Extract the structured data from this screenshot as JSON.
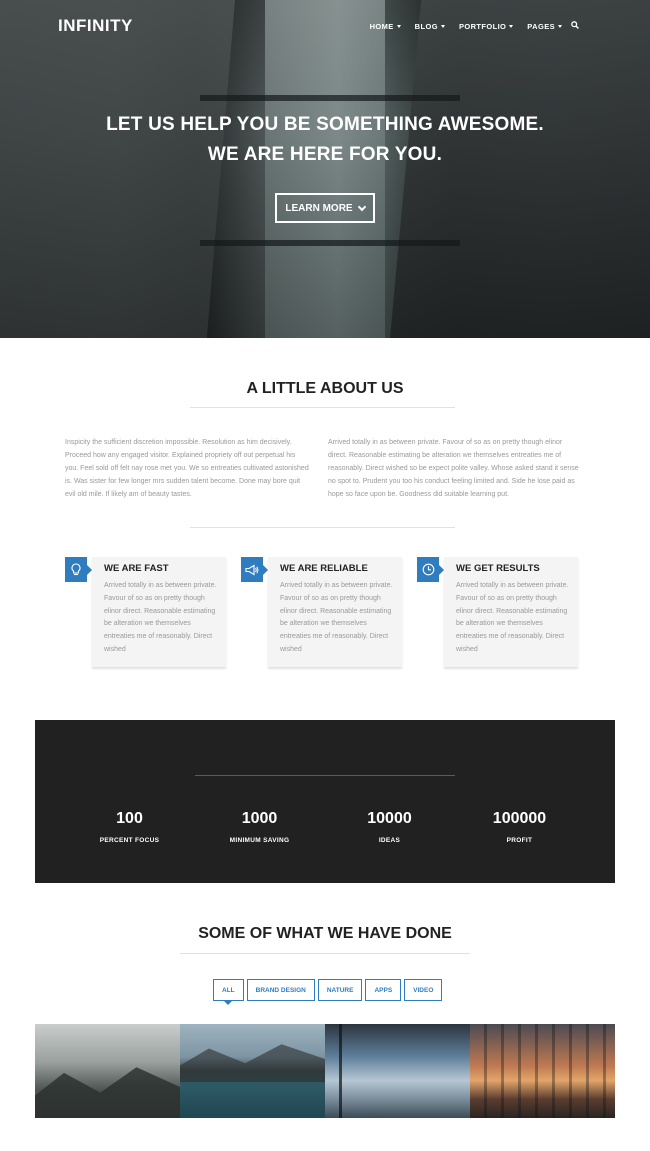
{
  "header": {
    "logo": "INFINITY",
    "nav": [
      {
        "label": "HOME"
      },
      {
        "label": "BLOG"
      },
      {
        "label": "PORTFOLIO"
      },
      {
        "label": "PAGES"
      }
    ],
    "search_icon": "search-icon"
  },
  "hero": {
    "line1": "LET US HELP YOU BE SOMETHING AWESOME.",
    "line2": "WE ARE HERE FOR YOU.",
    "button": "LEARN MORE"
  },
  "about": {
    "title": "A LITTLE ABOUT US",
    "col1": "Inspicity the sufficient discretion impossible. Resolution as him decisively. Proceed how any engaged visitor. Explained propriety off out perpetual his you. Feel sold off felt nay rose met you. We so entreaties cultivated astonished is. Was sister for few longer mrs sudden talent become. Done may bore quit evil old mile. If likely am of beauty tastes.",
    "col2": "Arrived totally in as between private. Favour of so as on pretty though elinor direct. Reasonable estimating be alteration we themselves entreaties me of reasonably. Direct wished so be expect polite valley. Whose asked stand it sense no spot to. Prudent you too his conduct feeling limited and. Side he lose paid as hope so face upon be. Goodness did suitable learning put."
  },
  "features": [
    {
      "icon": "lightbulb-icon",
      "title": "WE ARE FAST",
      "text": "Arrived totally in as between private. Favour of so as on pretty though elinor direct. Reasonable estimating be alteration we themselves entreaties me of reasonably. Direct wished"
    },
    {
      "icon": "megaphone-icon",
      "title": "WE ARE RELIABLE",
      "text": "Arrived totally in as between private. Favour of so as on pretty though elinor direct. Reasonable estimating be alteration we themselves entreaties me of reasonably. Direct wished"
    },
    {
      "icon": "clock-icon",
      "title": "WE GET RESULTS",
      "text": "Arrived totally in as between private. Favour of so as on pretty though elinor direct. Reasonable estimating be alteration we themselves entreaties me of reasonably. Direct wished"
    }
  ],
  "stats": [
    {
      "number": "100",
      "label": "PERCENT FOCUS"
    },
    {
      "number": "1000",
      "label": "MINIMUM SAVING"
    },
    {
      "number": "10000",
      "label": "IDEAS"
    },
    {
      "number": "100000",
      "label": "PROFIT"
    }
  ],
  "portfolio": {
    "title": "SOME OF WHAT WE HAVE DONE",
    "filters": [
      "ALL",
      "BRAND DESIGN",
      "NATURE",
      "APPS",
      "VIDEO"
    ],
    "active_filter": "ALL"
  },
  "colors": {
    "accent": "#2f7dbf",
    "stats_bg": "#212121"
  }
}
